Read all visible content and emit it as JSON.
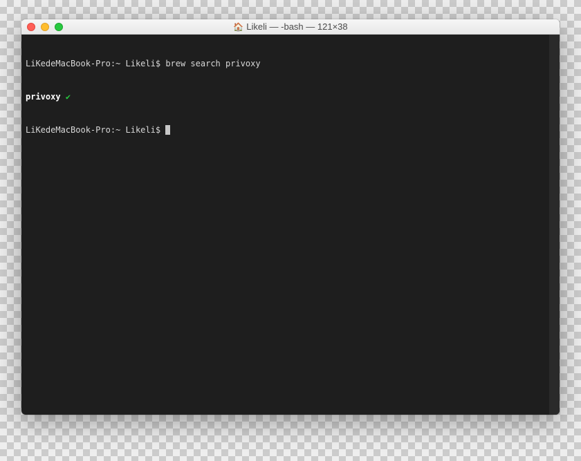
{
  "window": {
    "title": "Likeli — -bash — 121×38",
    "home_icon": "🏠"
  },
  "terminal": {
    "lines": {
      "l1_prompt_host": "LiKedeMacBook-Pro:",
      "l1_prompt_path": "~ Likeli$",
      "l1_command": "brew search privoxy",
      "l2_result": "privoxy",
      "l2_check": "✔",
      "l3_prompt_host": "LiKedeMacBook-Pro:",
      "l3_prompt_path": "~ Likeli$"
    }
  },
  "colors": {
    "terminal_bg": "#1e1e1e",
    "terminal_fg": "#d8d8d8",
    "check_green": "#27c93f"
  }
}
